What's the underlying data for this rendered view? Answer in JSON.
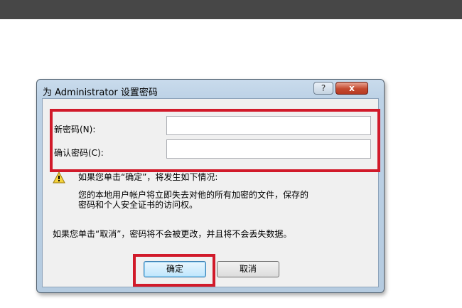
{
  "dialog": {
    "title": "为 Administrator 设置密码",
    "help_label": "?",
    "close_label": "x"
  },
  "form": {
    "new_password_label": "新密码(N):",
    "new_password_value": "",
    "confirm_password_label": "确认密码(C):",
    "confirm_password_value": ""
  },
  "warning": {
    "icon": "warning-icon",
    "line1": "如果您单击“确定”，将发生如下情况:",
    "line2": "您的本地用户帐户将立即失去对他的所有加密的文件，保存的",
    "line3": "密码和个人安全证书的访问权。"
  },
  "cancel_note": "如果您单击“取消”，密码将不会被更改，并且将不会丢失数据。",
  "buttons": {
    "ok_label": "确定",
    "cancel_label": "取消"
  },
  "colors": {
    "highlight": "#d11a2a",
    "top_bar": "#474747"
  }
}
